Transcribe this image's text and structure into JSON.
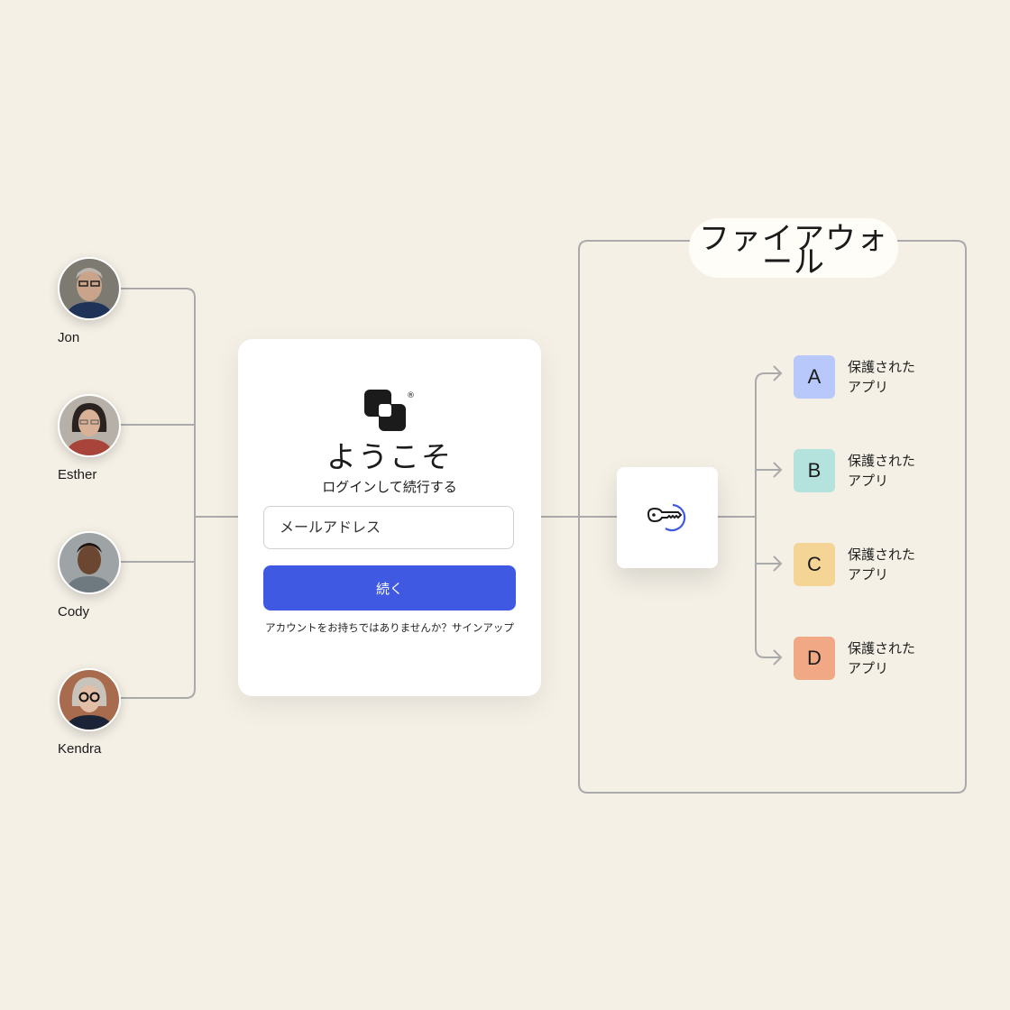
{
  "users": [
    {
      "name": "Jon",
      "skin": "#c9a48a",
      "hair": "#bdb7ad",
      "bg": "#7d7a72",
      "shirt": "#1f3358"
    },
    {
      "name": "Esther",
      "skin": "#d8b196",
      "hair": "#2a2220",
      "bg": "#b7b0a8",
      "shirt": "#a8443a"
    },
    {
      "name": "Cody",
      "skin": "#6b4630",
      "hair": "#1e1510",
      "bg": "#9ea3a6",
      "shirt": "#6e7a80"
    },
    {
      "name": "Kendra",
      "skin": "#e2bfa6",
      "hair": "#c9c4bb",
      "bg": "#a86b4e",
      "shirt": "#1b2436"
    }
  ],
  "login_card": {
    "title": "ようこそ",
    "subtitle": "ログインして続行する",
    "email_placeholder": "メールアドレス",
    "continue_label": "続く",
    "signup_text": "アカウントをお持ちではありませんか？サインアップ",
    "logo_icon": "brand-logo-icon",
    "registered_mark": "®"
  },
  "gateway": {
    "icon": "key-icon",
    "accent": "#4059e3"
  },
  "firewall": {
    "label": "ファイアウォール"
  },
  "apps": [
    {
      "letter": "A",
      "label_line1": "保護された",
      "label_line2": "アプリ",
      "color": "#b8c8fb"
    },
    {
      "letter": "B",
      "label_line1": "保護された",
      "label_line2": "アプリ",
      "color": "#b3e3dc"
    },
    {
      "letter": "C",
      "label_line1": "保護された",
      "label_line2": "アプリ",
      "color": "#f5d596"
    },
    {
      "letter": "D",
      "label_line1": "保護された",
      "label_line2": "アプリ",
      "color": "#f1a985"
    }
  ],
  "colors": {
    "background": "#f4f0e6",
    "line": "#a8a8a8",
    "button": "#4059e3"
  }
}
